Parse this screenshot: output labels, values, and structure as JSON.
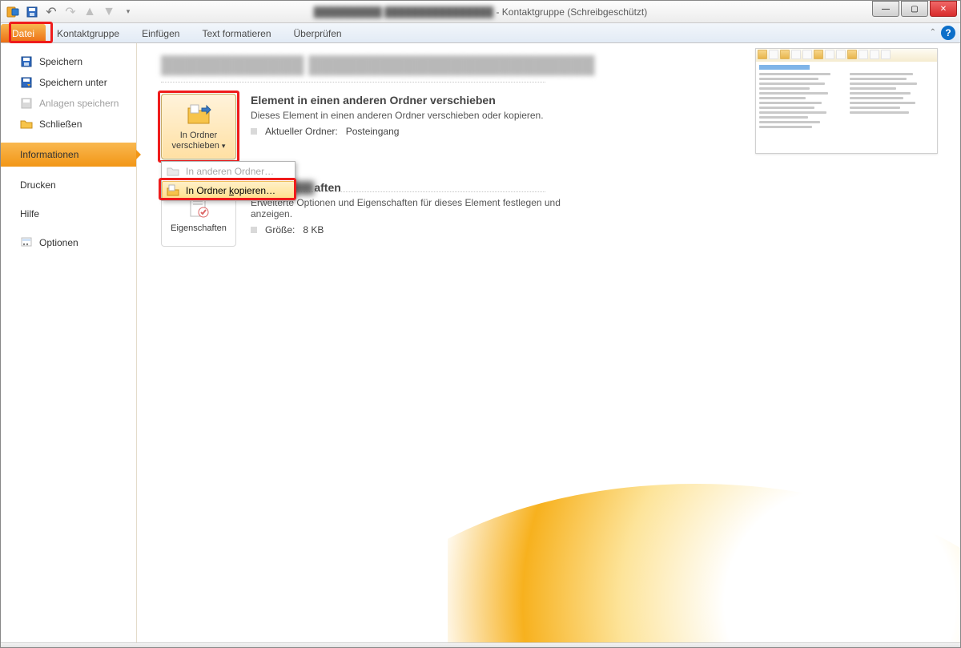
{
  "title": {
    "blurred": "██████████ ████████████████",
    "suffix": " - Kontaktgruppe  (Schreibgeschützt)"
  },
  "tabs": {
    "datei": "Datei",
    "kontaktgruppe": "Kontaktgruppe",
    "einfuegen": "Einfügen",
    "textformat": "Text formatieren",
    "ueberpruefen": "Überprüfen"
  },
  "nav": {
    "speichern": "Speichern",
    "speichern_unter": "Speichern unter",
    "anlagen": "Anlagen speichern",
    "schliessen": "Schließen",
    "informationen": "Informationen",
    "drucken": "Drucken",
    "hilfe": "Hilfe",
    "optionen": "Optionen"
  },
  "main": {
    "blurred_title": "████████████ ████████████████████████",
    "move": {
      "button": "In Ordner\nverschieben",
      "heading": "Element in einen anderen Ordner verschieben",
      "desc": "Dieses Element in einen anderen Ordner verschieben oder kopieren.",
      "folder_label": "Aktueller Ordner:",
      "folder_value": "Posteingang",
      "menu_other": "In anderen Ordner…",
      "menu_copy": "In Ordner kopieren…"
    },
    "props": {
      "button": "Eigenschaften",
      "heading_suffix": "aften",
      "desc": "Erweiterte Optionen und Eigenschaften für dieses Element festlegen und anzeigen.",
      "size_label": "Größe:",
      "size_value": "8 KB"
    }
  }
}
